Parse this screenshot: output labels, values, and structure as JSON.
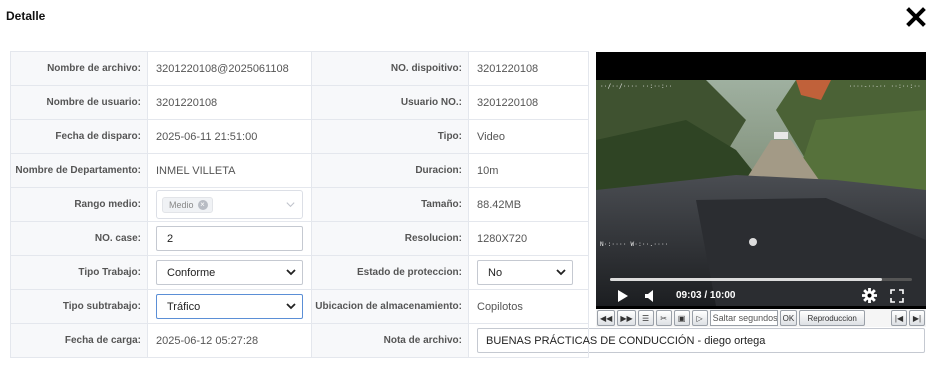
{
  "dialog": {
    "title": "Detalle",
    "close_icon": "close-icon"
  },
  "details": {
    "file_name_label": "Nombre de archivo:",
    "file_name": "3201220108@2025061108",
    "device_no_label": "NO. dispoitivo:",
    "device_no": "3201220108",
    "user_name_label": "Nombre de usuario:",
    "user_name": "3201220108",
    "user_no_label": "Usuario NO.:",
    "user_no": "3201220108",
    "trigger_date_label": "Fecha de disparo:",
    "trigger_date": "2025-06-11 21:51:00",
    "type_label": "Tipo:",
    "type": "Video",
    "department_label": "Nombre de Departamento:",
    "department": "INMEL VILLETA",
    "duration_label": "Duracion:",
    "duration": "10m",
    "range_label": "Rango medio:",
    "range_tag": "Medio",
    "size_label": "Tamaño:",
    "size": "88.42MB",
    "case_no_label": "NO. case:",
    "case_no": "2",
    "resolution_label": "Resolucion:",
    "resolution": "1280X720",
    "work_type_label": "Tipo Trabajo:",
    "work_type": "Conforme",
    "protection_label": "Estado de proteccion:",
    "protection": "No",
    "subwork_type_label": "Tipo subtrabajo:",
    "subwork_type": "Tráfico",
    "storage_label": "Ubicacion de almacenamiento:",
    "storage": "Copilotos",
    "upload_date_label": "Fecha de carga:",
    "upload_date": "2025-06-12 05:27:28",
    "file_note_label": "Nota de archivo:",
    "file_note": "BUENAS PRÁCTICAS DE CONDUCCIÓN - diego ortega"
  },
  "player": {
    "time_display": "09:03 / 10:00",
    "progress_fraction": 0.9,
    "icons": [
      "play-icon",
      "volume-icon",
      "gear-icon",
      "fullscreen-icon"
    ]
  },
  "toolbar": {
    "skip_placeholder": "Saltar segundos",
    "ok_label": "OK",
    "playback_label": "Reproduccion",
    "icons": [
      "rewind-icon",
      "fast-forward-icon",
      "list-icon",
      "scissors-icon",
      "snapshot-icon",
      "play-frame-icon",
      "prev-file-icon",
      "next-file-icon"
    ]
  },
  "colors": {
    "label_bg": "#f7f8fa",
    "border": "#e4e7ed",
    "focus_border": "#5b8fd6",
    "player_bg": "#000000"
  }
}
